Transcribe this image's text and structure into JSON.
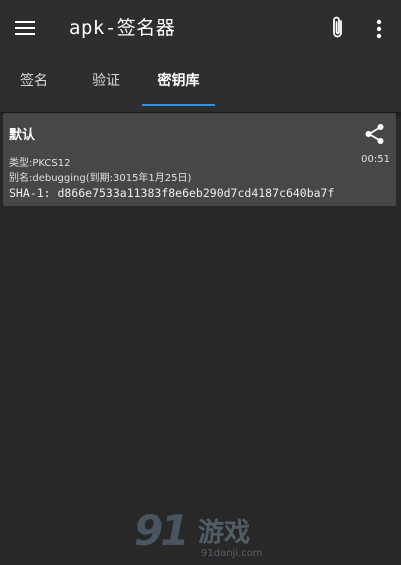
{
  "app": {
    "title": "apk-签名器"
  },
  "icons": {
    "menu": "hamburger-menu-icon",
    "attach": "paperclip-icon",
    "more": "more-vertical-icon",
    "share": "share-icon"
  },
  "tabs": [
    {
      "label": "签名",
      "active": false
    },
    {
      "label": "验证",
      "active": false
    },
    {
      "label": "密钥库",
      "active": true
    }
  ],
  "keystore": {
    "name": "默认",
    "type": "类型:PKCS12",
    "alias": "别名:debugging(到期:3015年1月25日)",
    "sha1": "SHA-1: d866e7533a11383f8e6eb290d7cd4187c640ba7f",
    "time": "00:51"
  },
  "watermark": {
    "logo": "91",
    "text": "游戏",
    "url": "91danji.com"
  },
  "colors": {
    "background": "#282828",
    "appbar": "#2e2e2e",
    "card": "#474747",
    "accent": "#3f8fd8"
  }
}
